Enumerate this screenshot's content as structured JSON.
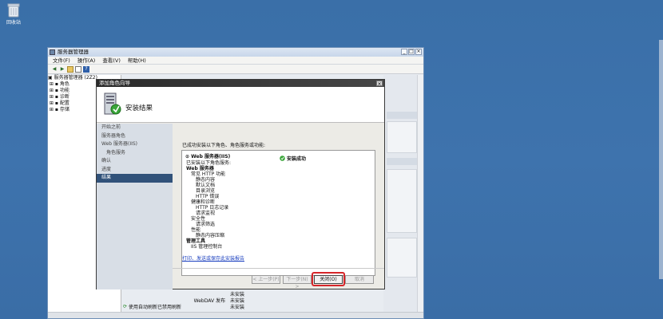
{
  "desktop": {
    "recycle_label": "回收站"
  },
  "server_manager": {
    "title": "服务器管理器",
    "menu": [
      "文件(F)",
      "操作(A)",
      "查看(V)",
      "帮助(H)"
    ],
    "tree": [
      "服务器管理器 (2Z2)",
      "角色",
      "功能",
      "诊断",
      "配置",
      "存储"
    ],
    "bottom_rows": [
      {
        "name": "",
        "status": "未安装"
      },
      {
        "name": "WebDAV 发布",
        "status": "未安装"
      },
      {
        "name": "",
        "status": "未安装"
      }
    ],
    "refresh_text": "使用自动刷新已禁用刷新"
  },
  "wizard": {
    "title": "添加角色向导",
    "header": "安装结果",
    "nav": [
      "开始之前",
      "服务器角色",
      "Web 服务器(IIS)",
      "角色服务",
      "确认",
      "进度",
      "结果"
    ],
    "intro": "已成功安装以下角色、角色服务或功能:",
    "role_name": "Web 服务器(IIS)",
    "success": "安装成功",
    "results": [
      "已安装以下角色服务:",
      "Web 服务器",
      "常见 HTTP 功能",
      "静态内容",
      "默认文档",
      "目录浏览",
      "HTTP 错误",
      "健康和诊断",
      "HTTP 日志记录",
      "请求监视",
      "安全性",
      "请求筛选",
      "性能",
      "静态内容压缩",
      "管理工具",
      "IIS 管理控制台"
    ],
    "link": "打印、发送或保存此安装报告",
    "buttons": {
      "prev": "< 上一步(P)",
      "next": "下一步(N) >",
      "close": "关闭(O)",
      "cancel": "取消"
    }
  }
}
